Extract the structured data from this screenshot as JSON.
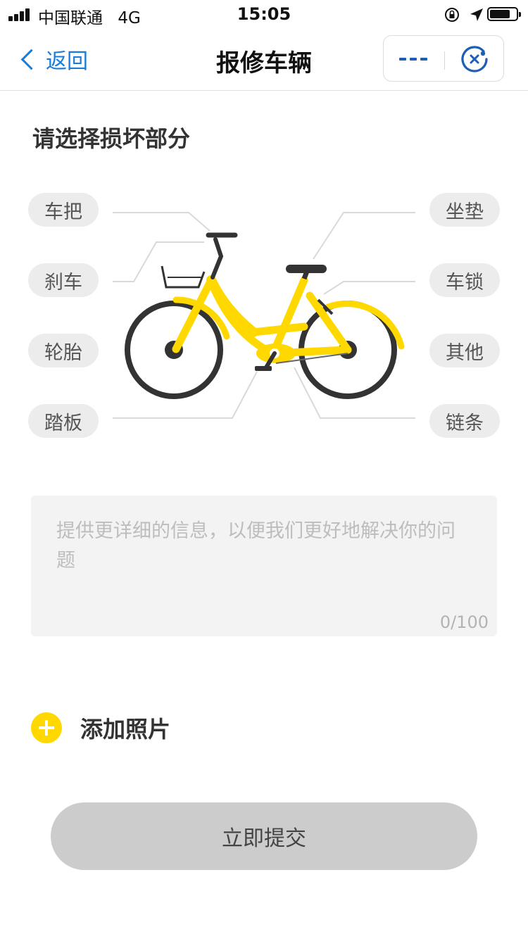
{
  "status_bar": {
    "carrier": "中国联通",
    "network": "4G",
    "time": "15:05"
  },
  "nav": {
    "back_label": "返回",
    "title": "报修车辆"
  },
  "section_title": "请选择损坏部分",
  "parts": {
    "handlebar": "车把",
    "brake": "刹车",
    "tire": "轮胎",
    "pedal": "踏板",
    "seat": "坐垫",
    "lock": "车锁",
    "other": "其他",
    "chain": "链条"
  },
  "description": {
    "placeholder": "提供更详细的信息，以便我们更好地解决你的问题",
    "value": "",
    "counter": "0/100"
  },
  "add_photo_label": "添加照片",
  "submit_label": "立即提交",
  "colors": {
    "accent": "#1a7cd6",
    "bike_yellow": "#ffd800",
    "button_disabled": "#cccccc"
  }
}
